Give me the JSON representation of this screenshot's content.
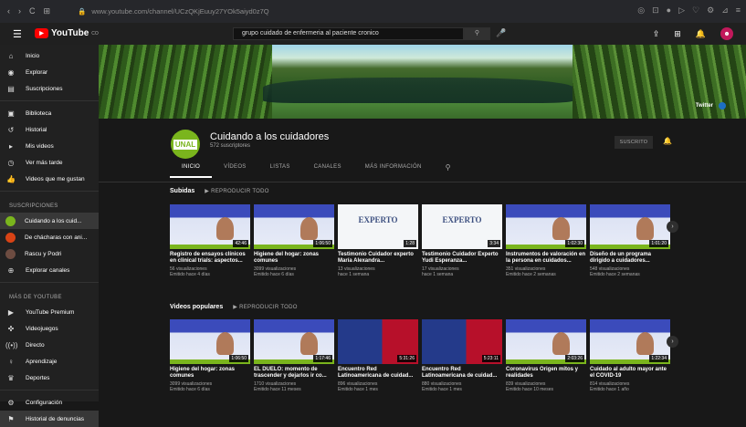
{
  "browser": {
    "url": "www.youtube.com/channel/UCzQKjEuuy27YOk5aiyd0z7Q",
    "nav_icons": [
      "‹",
      "›",
      "C",
      "⊞"
    ]
  },
  "header": {
    "logo": "YouTube",
    "logo_sup": "CO",
    "search_value": "grupo cuidado de enfermeria al paciente cronico"
  },
  "sidebar": {
    "main": [
      {
        "icon": "⌂",
        "label": "Inicio"
      },
      {
        "icon": "◉",
        "label": "Explorar"
      },
      {
        "icon": "▤",
        "label": "Suscripciones"
      }
    ],
    "library": [
      {
        "icon": "▣",
        "label": "Biblioteca"
      },
      {
        "icon": "↺",
        "label": "Historial"
      },
      {
        "icon": "▸",
        "label": "Mis videos"
      },
      {
        "icon": "◷",
        "label": "Ver más tarde"
      },
      {
        "icon": "👍",
        "label": "Videos que me gustan"
      }
    ],
    "subs_head": "SUSCRIPCIONES",
    "subs": [
      {
        "label": "Cuidando a los cuid...",
        "color": "#7ab51d"
      },
      {
        "label": "De chácharas con ani...",
        "color": "#d84315"
      },
      {
        "label": "Rascu y Podri",
        "color": "#6d4c41"
      },
      {
        "label": "Explorar canales",
        "color": "#555555"
      }
    ],
    "more_head": "MÁS DE YOUTUBE",
    "more": [
      {
        "icon": "▶",
        "label": "YouTube Premium"
      },
      {
        "icon": "✜",
        "label": "Videojuegos"
      },
      {
        "icon": "((•))",
        "label": "Directo"
      },
      {
        "icon": "♀",
        "label": "Aprendizaje"
      },
      {
        "icon": "♛",
        "label": "Deportes"
      }
    ],
    "bottom": [
      {
        "icon": "⚙",
        "label": "Configuración"
      },
      {
        "icon": "⚑",
        "label": "Historial de denuncias"
      }
    ]
  },
  "banner": {
    "social": "Twitter"
  },
  "channel": {
    "name": "Cuidando a los cuidadores",
    "subs": "572 suscriptores",
    "logo_text": "UNAL",
    "subscribe": "SUSCRITO"
  },
  "tabs": [
    "INICIO",
    "VÍDEOS",
    "LISTAS",
    "CANALES",
    "MÁS INFORMACIÓN"
  ],
  "shelf1": {
    "title": "Subidas",
    "play_all": "REPRODUCIR TODO",
    "videos": [
      {
        "type": "unal",
        "duration": "42:46",
        "title": "Registro de ensayos clínicos en clinical trials: aspectos...",
        "views": "56 visualizaciones",
        "date": "Emitido hace 4 días"
      },
      {
        "type": "unal",
        "duration": "1:06:50",
        "title": "Higiene del hogar: zonas comunes",
        "views": "3099 visualizaciones",
        "date": "Emitido hace 6 días"
      },
      {
        "type": "exp",
        "duration": "1:28",
        "title": "Testimonio Cuidador experto María Alexandra...",
        "views": "13 visualizaciones",
        "date": "hace 1 semana"
      },
      {
        "type": "exp",
        "duration": "3:34",
        "title": "Testimonio Cuidador Experto Yudi Esperanza...",
        "views": "17 visualizaciones",
        "date": "hace 1 semana"
      },
      {
        "type": "unal",
        "duration": "1:02:30",
        "title": "Instrumentos de valoración en la persona en cuidados...",
        "views": "351 visualizaciones",
        "date": "Emitido hace 2 semanas"
      },
      {
        "type": "unal",
        "duration": "1:01:20",
        "title": "Diseño de un programa dirigido a cuidadores...",
        "views": "548 visualizaciones",
        "date": "Emitido hace 2 semanas"
      }
    ]
  },
  "shelf2": {
    "title": "Videos populares",
    "play_all": "REPRODUCIR TODO",
    "videos": [
      {
        "type": "unal",
        "duration": "1:06:50",
        "title": "Higiene del hogar: zonas comunes",
        "views": "3099 visualizaciones",
        "date": "Emitido hace 6 días"
      },
      {
        "type": "unal",
        "duration": "1:17:46",
        "title": "EL DUELO: momento de trascender y dejarlos ir co...",
        "views": "1710 visualizaciones",
        "date": "Emitido hace 11 meses"
      },
      {
        "type": "red",
        "duration": "5:31:26",
        "title": "Encuentro Red Latinoamericana de cuidad...",
        "views": "896 visualizaciones",
        "date": "Emitido hace 1 mes"
      },
      {
        "type": "red",
        "duration": "5:23:11",
        "title": "Encuentro Red Latinoamericana de cuidad...",
        "views": "880 visualizaciones",
        "date": "Emitido hace 1 mes"
      },
      {
        "type": "unal",
        "duration": "2:03:26",
        "title": "Coronavirus Origen mitos y realidades",
        "views": "839 visualizaciones",
        "date": "Emitido hace 10 meses"
      },
      {
        "type": "unal",
        "duration": "1:22:34",
        "title": "Cuidado al adulto mayor ante el COVID-19",
        "views": "814 visualizaciones",
        "date": "Emitido hace 1 año"
      }
    ]
  }
}
